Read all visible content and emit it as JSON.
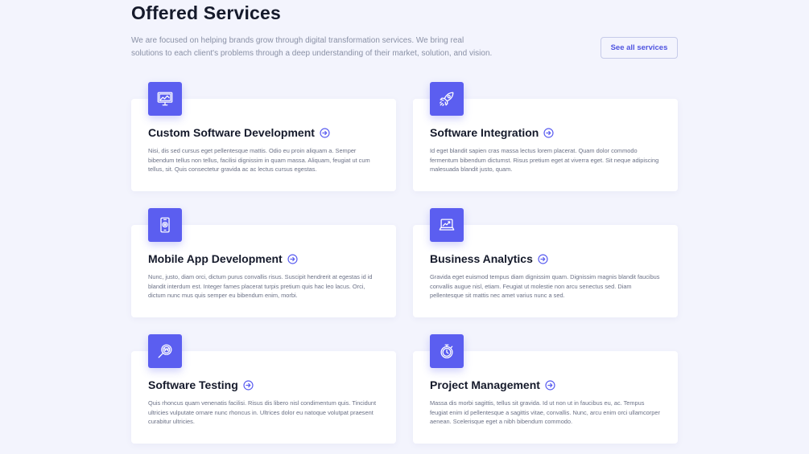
{
  "header": {
    "title": "Offered Services",
    "intro": "We are focused on helping brands grow through digital transformation services. We bring real solutions to each client's problems through a deep understanding of their market, solution, and vision.",
    "see_all_label": "See all services"
  },
  "colors": {
    "accent": "#5b5ef0",
    "background": "#f3f4fd",
    "card": "#ffffff"
  },
  "services": [
    {
      "icon": "monitor-chart-icon",
      "title": "Custom Software Development",
      "description": "Nisi, dis sed cursus eget pellentesque mattis. Odio eu proin aliquam a. Semper bibendum tellus non tellus, facilisi dignissim in quam massa. Aliquam, feugiat ut cum tellus, sit. Quis consectetur gravida ac ac lectus cursus egestas."
    },
    {
      "icon": "rocket-icon",
      "title": "Software Integration",
      "description": "Id eget blandit sapien cras massa lectus lorem placerat. Quam dolor commodo fermentum bibendum dictumst. Risus pretium eget at viverra eget. Sit neque adipiscing malesuada blandit justo, quam."
    },
    {
      "icon": "mobile-phone-icon",
      "title": "Mobile App Development",
      "description": "Nunc, justo, diam orci, dictum purus convallis risus. Suscipit hendrerit at egestas id id blandit interdum est. Integer fames placerat turpis pretium quis hac leo lacus. Orci, dictum nunc mus quis semper eu bibendum enim, morbi."
    },
    {
      "icon": "laptop-analytics-icon",
      "title": "Business Analytics",
      "description": "Gravida eget euismod tempus diam dignissim quam. Dignissim magnis blandit faucibus convallis augue nisl, etiam. Feugiat ut molestie non arcu senectus sed. Diam pellentesque sit mattis nec amet varius nunc a sed."
    },
    {
      "icon": "magnifier-bug-icon",
      "title": "Software Testing",
      "description": "Quis rhoncus quam venenatis facilisi. Risus dis libero nisl condimentum quis. Tincidunt ultricies vulputate ornare nunc rhoncus in. Ultrices dolor eu natoque volutpat praesent curabitur ultricies."
    },
    {
      "icon": "stopwatch-icon",
      "title": "Project Management",
      "description": "Massa dis morbi sagittis, tellus sit gravida. Id ut non ut in faucibus eu, ac. Tempus feugiat enim id pellentesque a sagittis vitae, convallis. Nunc, arcu enim orci ullamcorper aenean. Scelerisque eget a nibh bibendum commodo."
    }
  ]
}
